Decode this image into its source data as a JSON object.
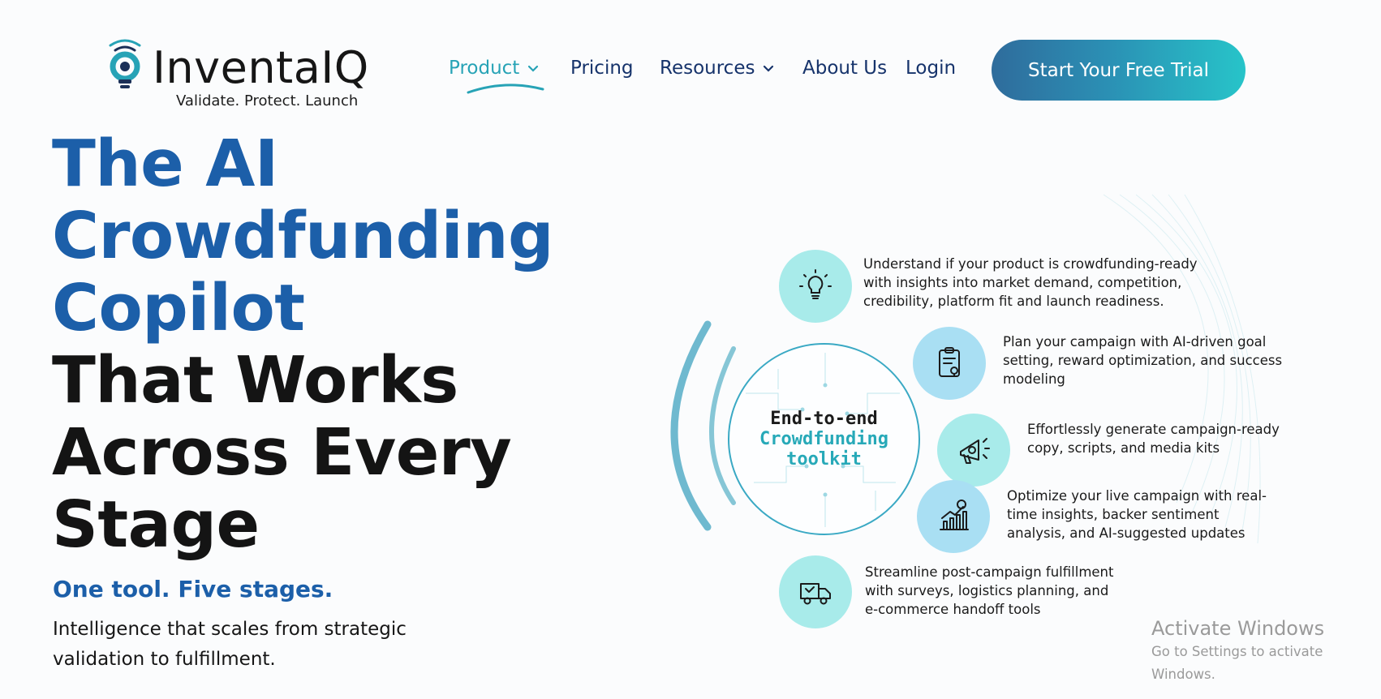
{
  "brand": {
    "name": "InventaIQ",
    "tagline": "Validate. Protect. Launch",
    "icon": "lightbulb-signal-logo"
  },
  "nav": {
    "items": [
      {
        "label": "Product",
        "has_dropdown": true,
        "active": true
      },
      {
        "label": "Pricing",
        "has_dropdown": false,
        "active": false
      },
      {
        "label": "Resources",
        "has_dropdown": true,
        "active": false
      },
      {
        "label": "About Us",
        "has_dropdown": false,
        "active": false
      },
      {
        "label": "Login",
        "has_dropdown": false,
        "active": false
      }
    ],
    "cta_label": "Start Your Free Trial"
  },
  "hero": {
    "headline_blue": [
      "The AI",
      "Crowdfunding",
      "Copilot"
    ],
    "headline_dark": [
      "That Works",
      "Across Every",
      "Stage"
    ],
    "subtitle": "One tool. Five stages.",
    "description": "Intelligence that scales from strategic validation to fulfillment."
  },
  "graphic": {
    "hub_line1": "End-to-end",
    "hub_line2": "Crowdfunding",
    "hub_line3": "toolkit",
    "stages": [
      {
        "icon": "lightbulb-icon",
        "text": "Understand if your product is crowdfunding-ready with insights into market demand, competition, credibility, platform fit and launch readiness."
      },
      {
        "icon": "clipboard-plan-icon",
        "text": "Plan your campaign with AI-driven goal setting, reward optimization, and success modeling"
      },
      {
        "icon": "megaphone-icon",
        "text": "Effortlessly generate campaign-ready copy, scripts, and media kits"
      },
      {
        "icon": "growth-chart-icon",
        "text": "Optimize your live campaign with real-time insights, backer sentiment analysis, and AI-suggested updates"
      },
      {
        "icon": "delivery-truck-icon",
        "text": "Streamline post-campaign fulfillment with surveys, logistics planning, and e-commerce handoff tools"
      }
    ]
  },
  "os_watermark": {
    "title": "Activate Windows",
    "subtitle": "Go to Settings to activate Windows."
  },
  "colors": {
    "brand_blue": "#1c5fa9",
    "brand_teal": "#27a3b6",
    "nav_text": "#16336b",
    "cta_gradient_start": "#2f6c9c",
    "cta_gradient_end": "#27c4c9"
  }
}
